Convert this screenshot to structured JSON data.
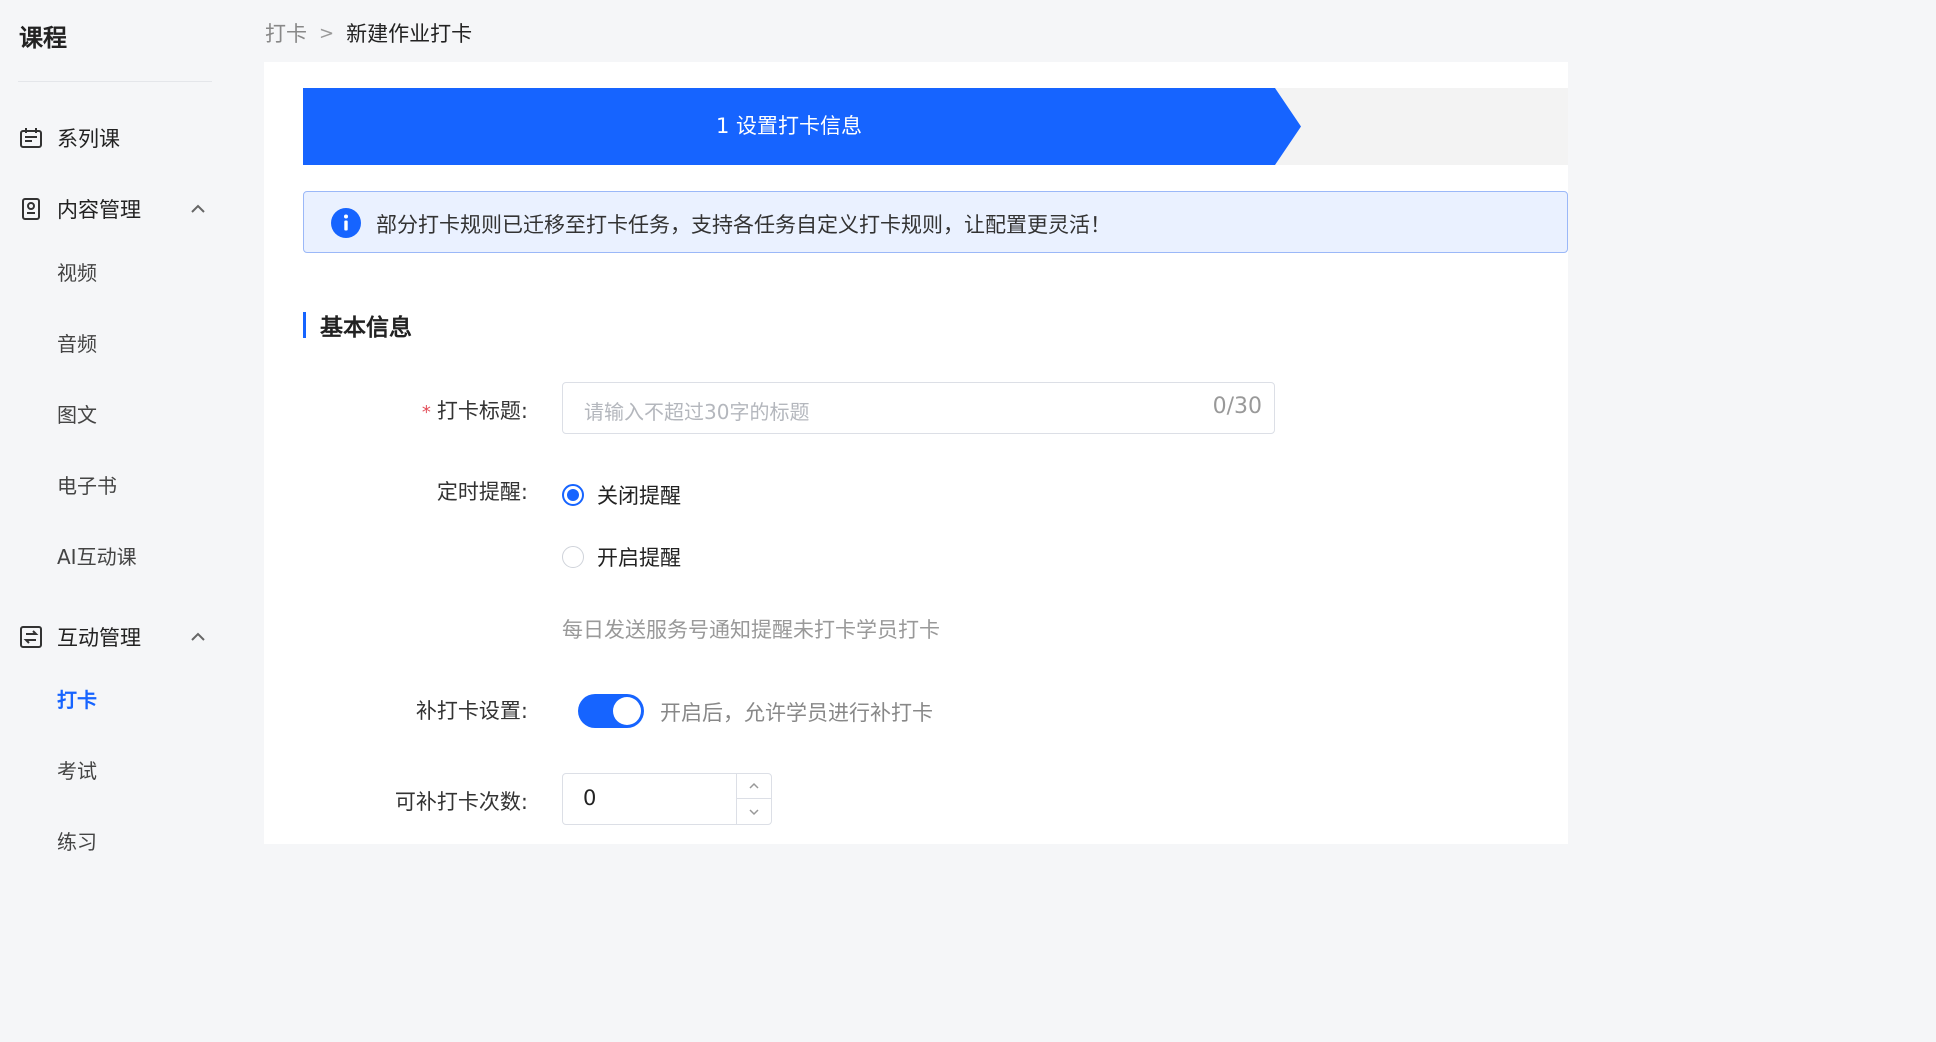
{
  "sidebar": {
    "title": "课程",
    "groups": [
      {
        "label": "系列课",
        "icon": "calendar-icon"
      },
      {
        "label": "内容管理",
        "icon": "document-icon",
        "items": [
          "视频",
          "音频",
          "图文",
          "电子书",
          "AI互动课"
        ]
      },
      {
        "label": "互动管理",
        "icon": "interaction-icon",
        "items": [
          "打卡",
          "考试",
          "练习"
        ]
      }
    ],
    "active_item": "打卡"
  },
  "breadcrumb": {
    "parent": "打卡",
    "separator": ">",
    "current": "新建作业打卡"
  },
  "steps": {
    "active_label": "1 设置打卡信息"
  },
  "notice": {
    "icon": "info-icon",
    "text": "部分打卡规则已迁移至打卡任务，支持各任务自定义打卡规则，让配置更灵活！"
  },
  "section": {
    "title": "基本信息"
  },
  "form": {
    "title_field": {
      "label": "打卡标题:",
      "required_mark": "*",
      "placeholder": "请输入不超过30字的标题",
      "counter": "0/30"
    },
    "reminder": {
      "label": "定时提醒:",
      "options": [
        "关闭提醒",
        "开启提醒"
      ],
      "selected": "关闭提醒",
      "hint": "每日发送服务号通知提醒未打卡学员打卡"
    },
    "makeup": {
      "label": "补打卡设置:",
      "enabled": true,
      "description": "开启后，允许学员进行补打卡"
    },
    "makeup_count": {
      "label": "可补打卡次数:",
      "value": "0"
    }
  },
  "colors": {
    "accent": "#1664ff",
    "notice_bg": "#eaf1ff",
    "required": "#e34d59"
  }
}
